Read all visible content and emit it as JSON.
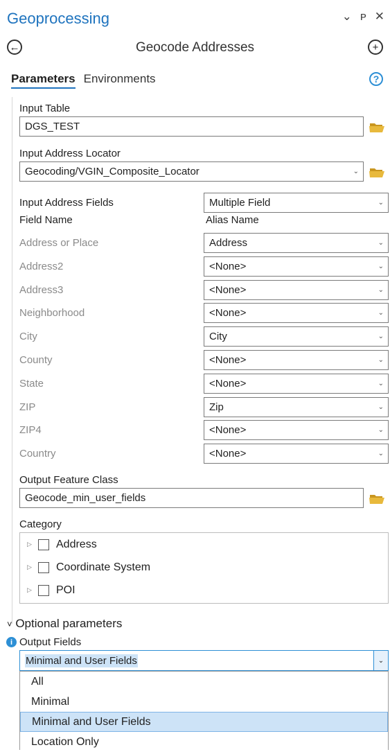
{
  "pane": {
    "title": "Geoprocessing",
    "controls": [
      "⌄",
      "ᴘ",
      "✕"
    ],
    "tool_title": "Geocode Addresses"
  },
  "tabs": {
    "parameters": "Parameters",
    "environments": "Environments"
  },
  "params": {
    "input_table_label": "Input Table",
    "input_table_value": "DGS_TEST",
    "locator_label": "Input Address Locator",
    "locator_value": "Geocoding/VGIN_Composite_Locator",
    "address_fields_label": "Input Address Fields",
    "address_fields_value": "Multiple Field",
    "field_name_header": "Field Name",
    "alias_name_header": "Alias Name",
    "field_rows": [
      {
        "field": "Address or Place",
        "alias": "Address"
      },
      {
        "field": "Address2",
        "alias": "<None>"
      },
      {
        "field": "Address3",
        "alias": "<None>"
      },
      {
        "field": "Neighborhood",
        "alias": "<None>"
      },
      {
        "field": "City",
        "alias": "City"
      },
      {
        "field": "County",
        "alias": "<None>"
      },
      {
        "field": "State",
        "alias": "<None>"
      },
      {
        "field": "ZIP",
        "alias": "Zip"
      },
      {
        "field": "ZIP4",
        "alias": "<None>"
      },
      {
        "field": "Country",
        "alias": "<None>"
      }
    ],
    "output_label": "Output Feature Class",
    "output_value": "Geocode_min_user_fields",
    "category_label": "Category",
    "categories": [
      "Address",
      "Coordinate System",
      "POI"
    ]
  },
  "optional": {
    "header": "Optional parameters",
    "output_fields_label": "Output Fields",
    "output_fields_value": "Minimal and User Fields",
    "options": [
      "All",
      "Minimal",
      "Minimal and User Fields",
      "Location Only"
    ],
    "selected_option": "Minimal and User Fields"
  },
  "colors": {
    "accent": "#1e73be",
    "selection": "#cde3f7",
    "folder": "#e8b93c"
  }
}
